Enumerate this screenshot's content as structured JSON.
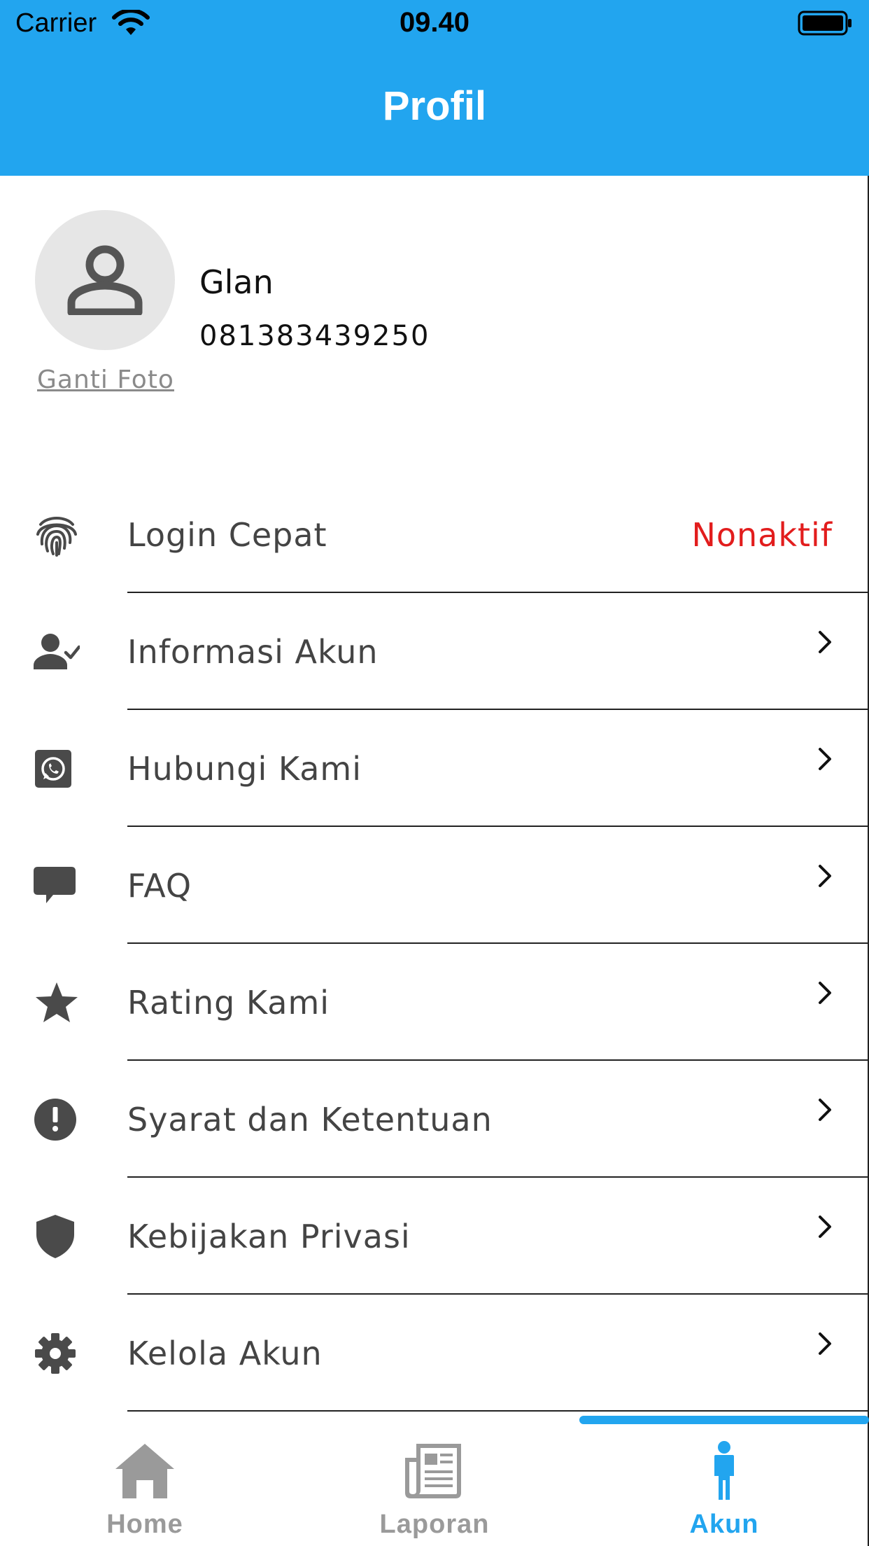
{
  "status_bar": {
    "carrier": "Carrier",
    "time": "09.40"
  },
  "header": {
    "title": "Profil"
  },
  "profile": {
    "name": "Glan",
    "phone": "081383439250",
    "change_photo_label": "Ganti Foto"
  },
  "menu": [
    {
      "label": "Login Cepat",
      "value": "Nonaktif",
      "icon": "fingerprint-icon"
    },
    {
      "label": "Informasi Akun",
      "icon": "user-check-icon"
    },
    {
      "label": "Hubungi Kami",
      "icon": "whatsapp-icon"
    },
    {
      "label": "FAQ",
      "icon": "chat-bubble-icon"
    },
    {
      "label": "Rating Kami",
      "icon": "star-icon"
    },
    {
      "label": "Syarat dan Ketentuan",
      "icon": "exclamation-icon"
    },
    {
      "label": "Kebijakan Privasi",
      "icon": "shield-icon"
    },
    {
      "label": "Kelola Akun",
      "icon": "gear-icon"
    }
  ],
  "bottom_nav": [
    {
      "label": "Home",
      "icon": "home-icon"
    },
    {
      "label": "Laporan",
      "icon": "newspaper-icon"
    },
    {
      "label": "Akun",
      "icon": "person-icon",
      "active": true
    }
  ],
  "colors": {
    "accent": "#22a5ef",
    "inactive": "#e21d1d",
    "icon": "#4a4a4a"
  }
}
